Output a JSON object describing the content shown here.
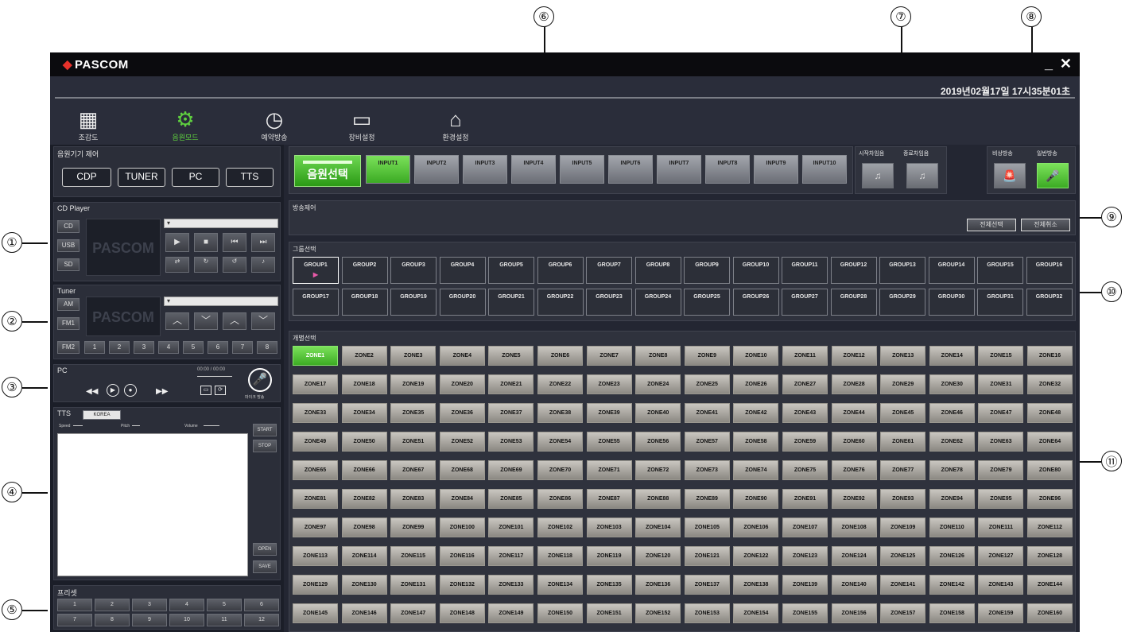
{
  "callouts": [
    "①",
    "②",
    "③",
    "④",
    "⑤",
    "⑥",
    "⑦",
    "⑧",
    "⑨",
    "⑩",
    "⑪"
  ],
  "app": {
    "name": "PASCOM",
    "minimize": "_",
    "close": "✕"
  },
  "datetime": "2019년02월17일 17시35분01초",
  "nav": [
    {
      "label": "조감도",
      "icon": "building-icon"
    },
    {
      "label": "음원모드",
      "icon": "gear-icon",
      "active": true
    },
    {
      "label": "예약방송",
      "icon": "clock-icon"
    },
    {
      "label": "장비설정",
      "icon": "computer-icon"
    },
    {
      "label": "환경설정",
      "icon": "house-icon"
    }
  ],
  "source_control": {
    "title": "음원기기 제어",
    "buttons": [
      "CDP",
      "TUNER",
      "PC",
      "TTS"
    ]
  },
  "cd_player": {
    "title": "CD Player",
    "side": [
      "CD",
      "USB",
      "SD"
    ],
    "display": "PASCOM",
    "transport": [
      "▶",
      "■",
      "⏮",
      "⏭"
    ]
  },
  "tuner": {
    "title": "Tuner",
    "side": [
      "AM",
      "FM1",
      "FM2"
    ],
    "display": "PASCOM",
    "presets": [
      "1",
      "2",
      "3",
      "4",
      "5",
      "6",
      "7",
      "8"
    ]
  },
  "pc": {
    "title": "PC",
    "time": "00:00 / 00:00",
    "mic_label": "마이크 방송"
  },
  "tts": {
    "title": "TTS",
    "language": "KOREA",
    "speed": "Speed",
    "pitch": "Pitch",
    "volume": "Volume",
    "buttons": [
      "START",
      "STOP",
      "OPEN",
      "SAVE"
    ]
  },
  "preset": {
    "title": "프리셋",
    "items": [
      "1",
      "2",
      "3",
      "4",
      "5",
      "6",
      "7",
      "8",
      "9",
      "10",
      "11",
      "12"
    ]
  },
  "source_select": {
    "label": "음원선택",
    "inputs": [
      "INPUT1",
      "INPUT2",
      "INPUT3",
      "INPUT4",
      "INPUT5",
      "INPUT6",
      "INPUT7",
      "INPUT8",
      "INPUT9",
      "INPUT10"
    ],
    "active": 0
  },
  "chime": {
    "start": "시작차임음",
    "end": "종료차임음"
  },
  "broadcast_mode": {
    "emergency": "비상방송",
    "general": "일반방송"
  },
  "broadcast_control": {
    "title": "방송제어",
    "select_all": "전체선택",
    "deselect_all": "전체취소"
  },
  "group_select": {
    "title": "그룹선택",
    "selected": 0
  },
  "zone_select": {
    "title": "개별선택",
    "selected": 0,
    "count": 160
  },
  "colors": {
    "accent": "#5fd13f",
    "window_bg": "#232632",
    "zone_bg": "#b5b2ab"
  }
}
